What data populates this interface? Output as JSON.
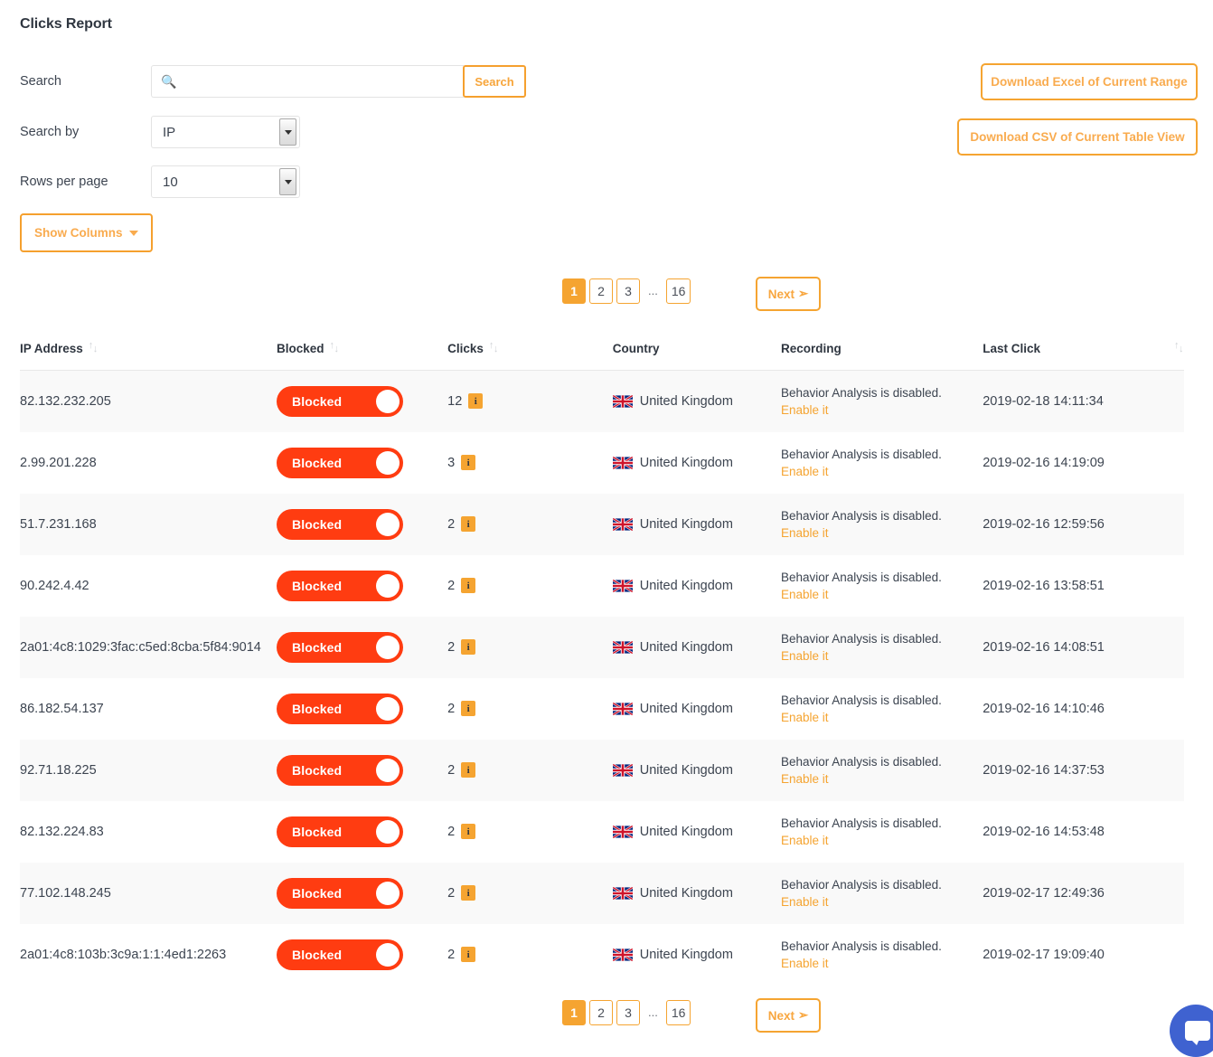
{
  "page": {
    "title": "Clicks Report"
  },
  "controls": {
    "search_label": "Search",
    "search_value": "",
    "search_placeholder": "🔍",
    "search_button": "Search",
    "search_by_label": "Search by",
    "search_by_value": "IP",
    "rows_per_page_label": "Rows per page",
    "rows_per_page_value": "10",
    "show_columns_button": "Show Columns"
  },
  "downloads": {
    "excel_button": "Download Excel of Current Range",
    "csv_button": "Download CSV of Current Table View"
  },
  "pagination": {
    "pages": [
      "1",
      "2",
      "3"
    ],
    "ellipsis": "...",
    "last_page": "16",
    "active_page": "1",
    "next_label": "Next",
    "next_icon": "arrow-right-icon"
  },
  "table": {
    "columns": [
      {
        "label": "IP Address",
        "sortable": true
      },
      {
        "label": "Blocked",
        "sortable": true
      },
      {
        "label": "Clicks",
        "sortable": true
      },
      {
        "label": "Country",
        "sortable": true
      },
      {
        "label": "Recording",
        "sortable": false
      },
      {
        "label": "Last Click",
        "sortable": true
      }
    ],
    "recording_text": "Behavior Analysis is disabled.",
    "recording_link": "Enable it",
    "blocked_label": "Blocked",
    "rows": [
      {
        "ip": "82.132.232.205",
        "blocked": "Blocked",
        "clicks": "12",
        "country": "United Kingdom",
        "recording_text": "Behavior Analysis is disabled.",
        "recording_link": "Enable it",
        "last_click": "2019-02-18 14:11:34"
      },
      {
        "ip": "2.99.201.228",
        "blocked": "Blocked",
        "clicks": "3",
        "country": "United Kingdom",
        "recording_text": "Behavior Analysis is disabled.",
        "recording_link": "Enable it",
        "last_click": "2019-02-16 14:19:09"
      },
      {
        "ip": "51.7.231.168",
        "blocked": "Blocked",
        "clicks": "2",
        "country": "United Kingdom",
        "recording_text": "Behavior Analysis is disabled.",
        "recording_link": "Enable it",
        "last_click": "2019-02-16 12:59:56"
      },
      {
        "ip": "90.242.4.42",
        "blocked": "Blocked",
        "clicks": "2",
        "country": "United Kingdom",
        "recording_text": "Behavior Analysis is disabled.",
        "recording_link": "Enable it",
        "last_click": "2019-02-16 13:58:51"
      },
      {
        "ip": "2a01:4c8:1029:3fac:c5ed:8cba:5f84:9014",
        "blocked": "Blocked",
        "clicks": "2",
        "country": "United Kingdom",
        "recording_text": "Behavior Analysis is disabled.",
        "recording_link": "Enable it",
        "last_click": "2019-02-16 14:08:51"
      },
      {
        "ip": "86.182.54.137",
        "blocked": "Blocked",
        "clicks": "2",
        "country": "United Kingdom",
        "recording_text": "Behavior Analysis is disabled.",
        "recording_link": "Enable it",
        "last_click": "2019-02-16 14:10:46"
      },
      {
        "ip": "92.71.18.225",
        "blocked": "Blocked",
        "clicks": "2",
        "country": "United Kingdom",
        "recording_text": "Behavior Analysis is disabled.",
        "recording_link": "Enable it",
        "last_click": "2019-02-16 14:37:53"
      },
      {
        "ip": "82.132.224.83",
        "blocked": "Blocked",
        "clicks": "2",
        "country": "United Kingdom",
        "recording_text": "Behavior Analysis is disabled.",
        "recording_link": "Enable it",
        "last_click": "2019-02-16 14:53:48"
      },
      {
        "ip": "77.102.148.245",
        "blocked": "Blocked",
        "clicks": "2",
        "country": "United Kingdom",
        "recording_text": "Behavior Analysis is disabled.",
        "recording_link": "Enable it",
        "last_click": "2019-02-17 12:49:36"
      },
      {
        "ip": "2a01:4c8:103b:3c9a:1:1:4ed1:2263",
        "blocked": "Blocked",
        "clicks": "2",
        "country": "United Kingdom",
        "recording_text": "Behavior Analysis is disabled.",
        "recording_link": "Enable it",
        "last_click": "2019-02-17 19:09:40"
      }
    ]
  },
  "chat": {
    "icon": "chat-bubble-icon"
  },
  "colors": {
    "accent_orange": "#f5a431",
    "blocked_red": "#ff3c11",
    "text_dark": "#3c4450",
    "row_stripe": "#f9f9f9",
    "chat_blue": "#3f62d0"
  }
}
